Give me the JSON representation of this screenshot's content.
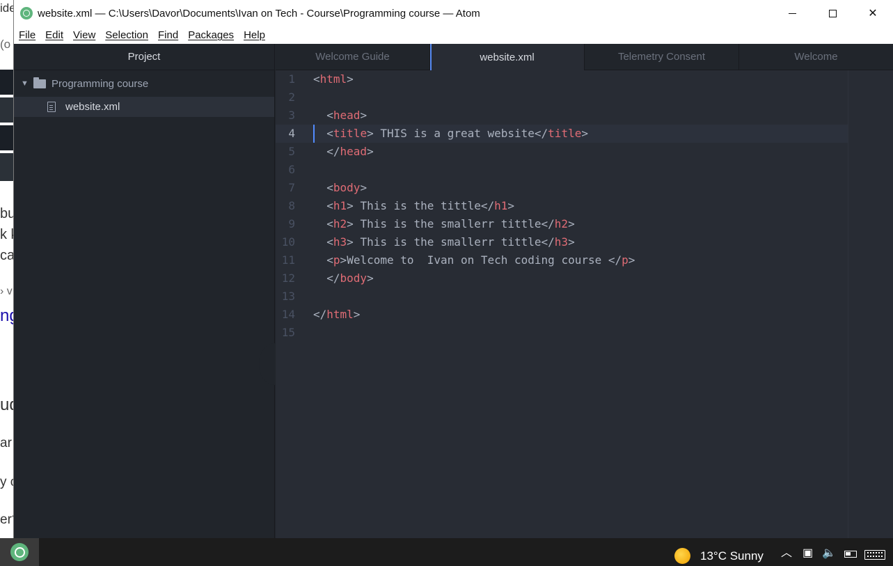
{
  "window": {
    "title": "website.xml — C:\\Users\\Davor\\Documents\\Ivan on Tech - Course\\Programming course — Atom",
    "minimize_icon": "minimize-icon",
    "maximize_icon": "maximize-icon",
    "close_label": "✕"
  },
  "menu": [
    "File",
    "Edit",
    "View",
    "Selection",
    "Find",
    "Packages",
    "Help"
  ],
  "tree": {
    "header": "Project",
    "root_folder": "Programming course",
    "files": [
      "website.xml"
    ]
  },
  "tabs": [
    {
      "label": "Welcome Guide",
      "active": false
    },
    {
      "label": "website.xml",
      "active": true
    },
    {
      "label": "Telemetry Consent",
      "active": false
    },
    {
      "label": "Welcome",
      "active": false
    }
  ],
  "editor": {
    "cursor_line": 4,
    "lines": [
      "<html>",
      "",
      "  <head>",
      "  <title> THIS is a great website</title>",
      "  </head>",
      "",
      "  <body>",
      "  <h1> This is the tittle</h1>",
      "  <h2> This is the smallerr tittle</h2>",
      "  <h3> This is the smallerr tittle</h3>",
      "  <p>Welcome to  Ivan on Tech coding course </p>",
      "  </body>",
      "",
      "</html>",
      ""
    ]
  },
  "background_page": {
    "fragments": [
      "ide",
      "(o",
      "bu",
      "k k",
      "cat",
      "› v",
      "ng",
      "ud",
      "ar",
      "y c",
      "er?"
    ]
  },
  "taskbar": {
    "weather": "13°C  Sunny",
    "tray_chevron": "︿"
  },
  "colors": {
    "tag": "#e06c75",
    "text": "#abb2bf",
    "editor_bg": "#282c34",
    "panel_bg": "#21252b",
    "accent": "#568af2"
  }
}
